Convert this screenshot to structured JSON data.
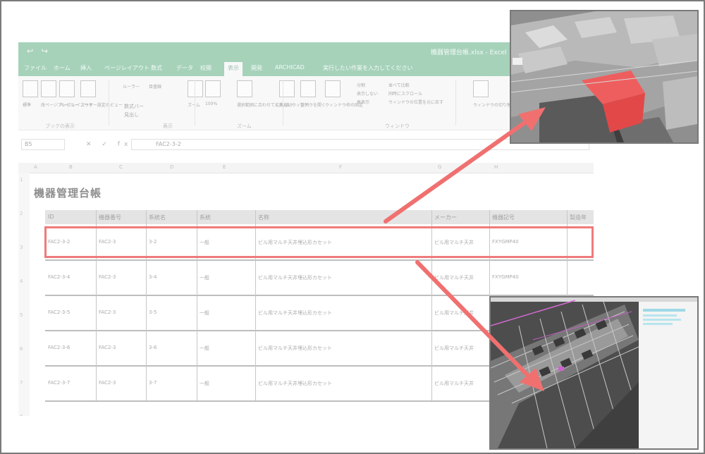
{
  "excel": {
    "title": "機器管理台帳.xlsx - Excel",
    "qat": "↩ ↪",
    "tabs": [
      "ファイル",
      "ホーム",
      "挿入",
      "ページレイアウト",
      "数式",
      "データ",
      "校閲",
      "表示",
      "開発",
      "ARCHICAD",
      "実行したい作業を入力してください"
    ],
    "active_tab_index": 7,
    "ribbon": {
      "buttons": [
        "標準",
        "改ページプレビュー",
        "ページレイアウト",
        "ユーザー設定のビュー",
        "ルーラー",
        "目盛線",
        "ズーム",
        "100%",
        "選択範囲に合わせて拡大/縮小",
        "新しいウィンドウを開く",
        "整列",
        "ウィンドウ枠の固定",
        "分割",
        "表示しない",
        "再表示",
        "並べて比較",
        "同時にスクロール",
        "ウィンドウの位置を元に戻す",
        "ウィンドウの切り替え",
        "マクロ"
      ],
      "checks": [
        "数式バー",
        "見出し"
      ],
      "groups": [
        "ブックの表示",
        "表示",
        "ズーム",
        "ウィンドウ"
      ]
    },
    "name_box": "B5",
    "formula_icons": "✕ ✓ fx",
    "formula_value": "FAC2-3-2",
    "column_headers": [
      "A",
      "B",
      "C",
      "D",
      "E",
      "F",
      "G",
      "H"
    ],
    "row_headers": [
      "1",
      "2",
      "3",
      "4",
      "5",
      "6",
      "7",
      "8"
    ],
    "sheet_title": "機器管理台帳",
    "table": {
      "headers": [
        "ID",
        "機器番号",
        "系統名",
        "系統",
        "名称",
        "メーカー",
        "機器記号",
        "製造年"
      ],
      "rows": [
        [
          "FAC2-3-2",
          "FAC2-3",
          "3-2",
          "一般",
          "ビル用マルチ天井埋込形カセット",
          "ビル用マルチ天井",
          "FXYGMP40",
          ""
        ],
        [
          "FAC2-3-4",
          "FAC2-3",
          "3-4",
          "一般",
          "ビル用マルチ天井埋込形カセット",
          "ビル用マルチ天井",
          "FXYGMP40",
          ""
        ],
        [
          "FAC2-3-5",
          "FAC2-3",
          "3-5",
          "一般",
          "ビル用マルチ天井埋込形カセット",
          "ビル用マルチ天井",
          "FXYGMP40",
          ""
        ],
        [
          "FAC2-3-6",
          "FAC2-3",
          "3-6",
          "一般",
          "ビル用マルチ天井埋込形カセット",
          "ビル用マルチ天井",
          "FXYGMP40",
          ""
        ],
        [
          "FAC2-3-7",
          "FAC2-3",
          "3-7",
          "一般",
          "ビル用マルチ天井埋込形カセット",
          "ビル用マルチ天井",
          "FXYGMP40",
          ""
        ]
      ]
    }
  },
  "colors": {
    "excel_green": "#5fae83",
    "highlight": "#f07a7a",
    "arrow": "#f07070",
    "model_red": "#ee5e5e"
  }
}
